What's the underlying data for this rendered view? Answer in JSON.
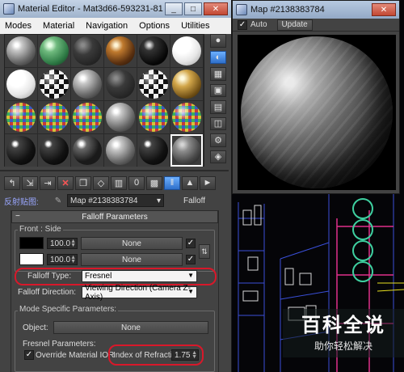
{
  "material_editor": {
    "title": "Material Editor - Mat3d66-593231-81-...",
    "window_buttons": {
      "minimize": "_",
      "maximize": "□",
      "close": "✕"
    },
    "menu": [
      "Modes",
      "Material",
      "Navigation",
      "Options",
      "Utilities"
    ],
    "slots": [
      "grey",
      "green",
      "dark",
      "bronze",
      "black",
      "white",
      "white",
      "check",
      "grey",
      "dark",
      "check",
      "gold",
      "color",
      "color",
      "color",
      "grey",
      "color",
      "color",
      "darkgloss",
      "darkgloss",
      "redgloss",
      "grey",
      "darkgloss",
      "marble"
    ],
    "active_slot_index": 23,
    "side_tools": [
      "sample-sphere-icon",
      "backlight-icon",
      "background-icon",
      "tiling-icon",
      "video-check-icon",
      "make-preview-icon",
      "options-icon",
      "select-by-material-icon",
      "material-map-navigator-icon"
    ],
    "bottom_tools": [
      "get-material-icon",
      "put-to-scene-icon",
      "assign-to-selection-icon",
      "reset-map-icon",
      "make-copy-icon",
      "make-unique-icon",
      "put-to-library-icon",
      "material-id-channel-icon",
      "show-shaded-map-icon",
      "show-end-result-icon",
      "go-to-parent-icon",
      "go-forward-to-sibling-icon"
    ],
    "map_label": "反射贴图:",
    "map_name": "Map #2138383784",
    "map_type": "Falloff",
    "rollout_title": "Falloff Parameters",
    "front_side": {
      "title": "Front : Side",
      "row1": {
        "value": "100.0",
        "map": "None",
        "color": "#000000"
      },
      "row2": {
        "value": "100.0",
        "map": "None",
        "color": "#ffffff"
      }
    },
    "falloff_type_label": "Falloff Type:",
    "falloff_type_value": "Fresnel",
    "falloff_direction_label": "Falloff Direction:",
    "falloff_direction_value": "Viewing Direction (Camera Z-Axis)",
    "mode_specific": {
      "title": "Mode Specific Parameters:",
      "object_label": "Object:",
      "object_value": "None",
      "fresnel_title": "Fresnel Parameters:",
      "override_ior_label": "Override Material IOR",
      "override_ior_checked": true,
      "ior_label": "Index of Refraction",
      "ior_value": "1.75"
    }
  },
  "map_window": {
    "title": "Map #2138383784",
    "auto_label": "Auto",
    "auto_checked": true,
    "update_label": "Update"
  },
  "watermark": {
    "big": "百科全说",
    "small": "助你轻松解决"
  }
}
